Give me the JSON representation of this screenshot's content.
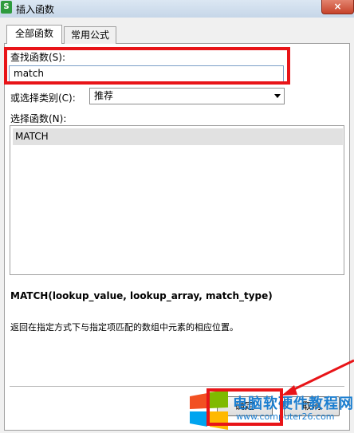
{
  "window": {
    "title": "插入函数",
    "app_icon": "S",
    "close_glyph": "×"
  },
  "tabs": [
    {
      "label": "全部函数",
      "active": true
    },
    {
      "label": "常用公式",
      "active": false
    }
  ],
  "search": {
    "label": "查找函数(S):",
    "value": "match"
  },
  "category": {
    "label": "或选择类别(C):",
    "selected": "推荐"
  },
  "function_list": {
    "label": "选择函数(N):",
    "items": [
      "MATCH"
    ]
  },
  "detail": {
    "signature": "MATCH(lookup_value, lookup_array, match_type)",
    "description": "返回在指定方式下与指定项匹配的数组中元素的相应位置。"
  },
  "buttons": {
    "ok": "确定",
    "cancel": "取消"
  },
  "watermark": {
    "text": "电脑软硬件教程网",
    "url": "www.computer26.com"
  },
  "colors": {
    "highlight": "#e81418",
    "watermark": "#1d7fd0"
  }
}
